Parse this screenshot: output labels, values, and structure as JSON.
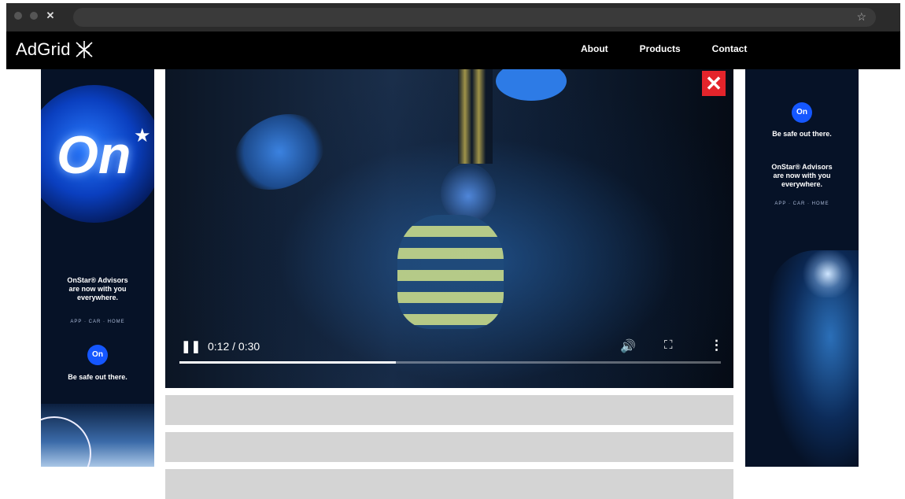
{
  "browser": {
    "window_icons": [
      "minimize-dot",
      "zoom-dot",
      "close-icon"
    ],
    "close_glyph": "✕",
    "bookmark_glyph": "☆"
  },
  "header": {
    "logo_text": "AdGrid",
    "logo_icon": "starburst-icon",
    "nav": [
      "About",
      "Products",
      "Contact"
    ],
    "background": "#000000"
  },
  "ads": {
    "left": {
      "big_logo": "On",
      "copy": "OnStar® Advisors\nare now with you\neverywhere.",
      "sub": "APP · CAR · HOME",
      "badge": "On",
      "tagline": "Be safe out there."
    },
    "right": {
      "badge": "On",
      "tagline": "Be safe out there.",
      "copy": "OnStar® Advisors\nare now with you\neverywhere.",
      "sub": "APP · CAR · HOME"
    }
  },
  "video": {
    "time": "0:12 / 0:30",
    "progress": 0.4,
    "close_glyph": "✕",
    "pause_glyph": "❚❚",
    "volume_glyph": "🔊",
    "fullscreen_glyph": "⛶",
    "more_glyph": "⋮",
    "close_color": "#e3242b"
  }
}
